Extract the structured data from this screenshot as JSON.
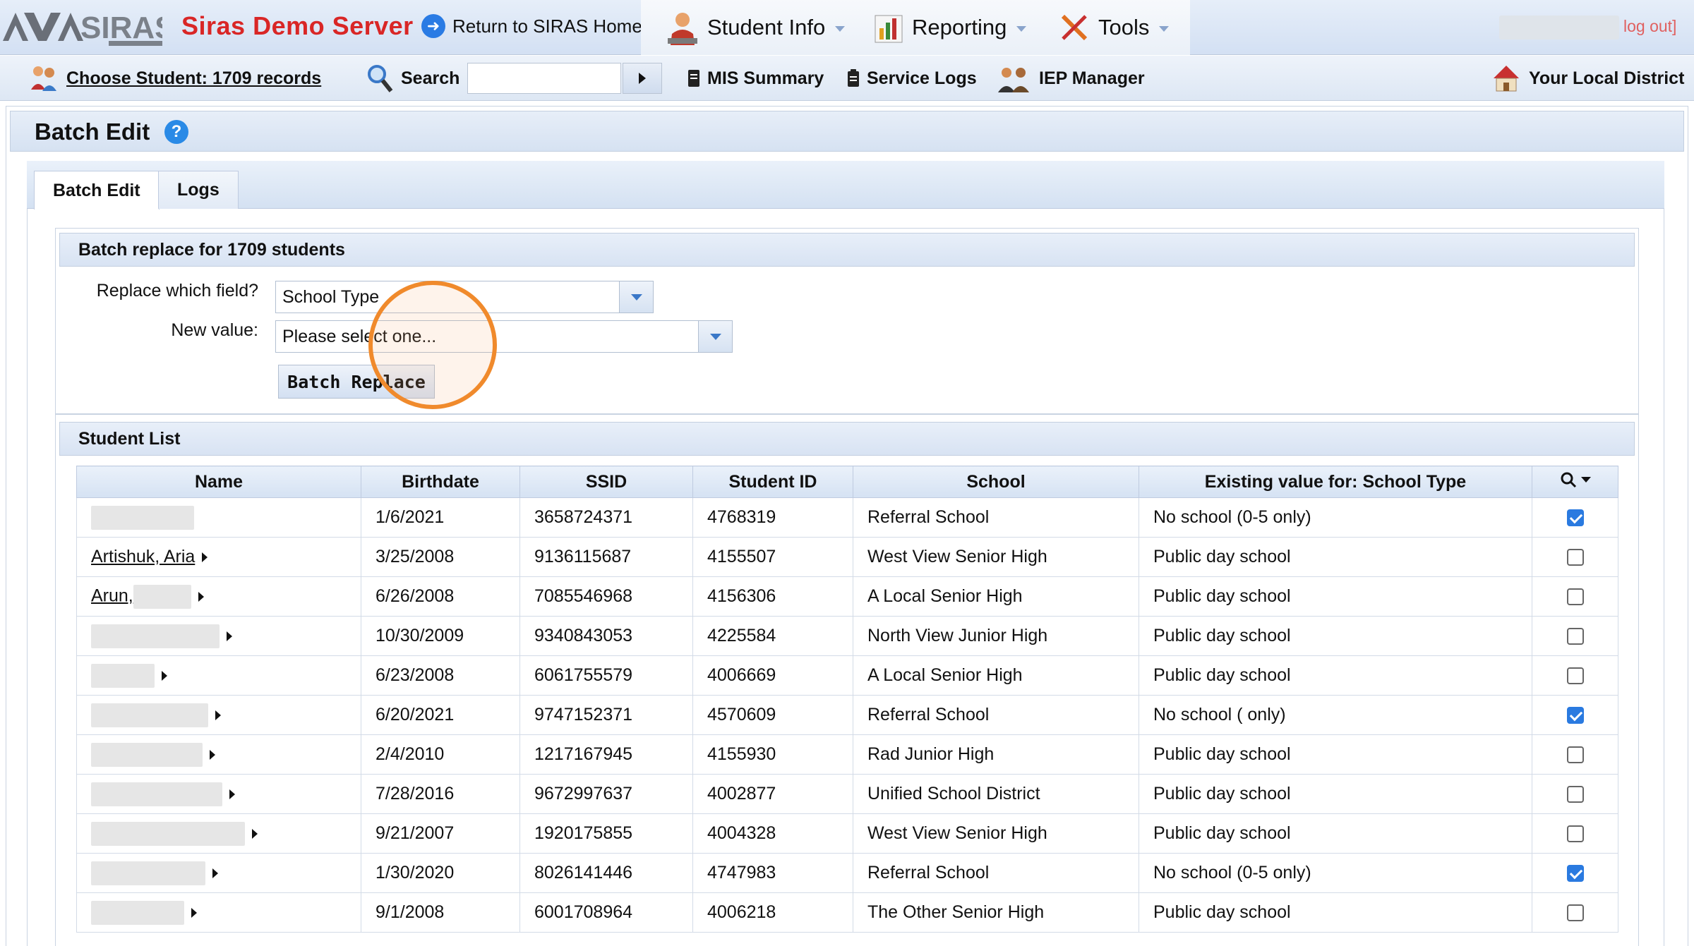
{
  "header": {
    "server_name": "Siras Demo Server",
    "return_home": "Return to SIRAS Home",
    "menu": [
      {
        "label": "Student Info",
        "icon": "student-icon"
      },
      {
        "label": "Reporting",
        "icon": "reporting-icon"
      },
      {
        "label": "Tools",
        "icon": "tools-icon"
      }
    ],
    "logout": "log out]"
  },
  "toolbar": {
    "choose_student": "Choose Student: 1709 records",
    "search_label": "Search",
    "search_value": "",
    "mis_summary": "MIS Summary",
    "service_logs": "Service Logs",
    "iep_manager": "IEP Manager",
    "district": "Your Local District"
  },
  "page": {
    "title": "Batch Edit",
    "help": "?"
  },
  "tabs": [
    {
      "label": "Batch Edit",
      "active": true
    },
    {
      "label": "Logs",
      "active": false
    }
  ],
  "batch": {
    "header": "Batch replace for 1709 students",
    "field_label": "Replace which field?",
    "field_value": "School Type",
    "value_label": "New value:",
    "value_placeholder": "Please select one...",
    "button": "Batch Replace"
  },
  "student_list": {
    "header": "Student List",
    "columns": [
      "Name",
      "Birthdate",
      "SSID",
      "Student ID",
      "School",
      "Existing value for: School Type"
    ],
    "rows": [
      {
        "name": "",
        "blur_w": 0,
        "birthdate": "1/6/2021",
        "ssid": "3658724371",
        "student_id": "4768319",
        "school": "Referral School",
        "existing": "No school (0-5 only)",
        "checked": true
      },
      {
        "name": "Artishuk, Aria",
        "birthdate": "3/25/2008",
        "ssid": "9136115687",
        "student_id": "4155507",
        "school": "West View Senior High",
        "existing": "Public day school",
        "checked": false
      },
      {
        "name": "Arun,",
        "birthdate": "6/26/2008",
        "ssid": "7085546968",
        "student_id": "4156306",
        "school": "A Local Senior High",
        "existing": "Public day school",
        "checked": false
      },
      {
        "name": "",
        "birthdate": "10/30/2009",
        "ssid": "9340843053",
        "student_id": "4225584",
        "school": "North View Junior High",
        "existing": "Public day school",
        "checked": false
      },
      {
        "name": "",
        "birthdate": "6/23/2008",
        "ssid": "6061755579",
        "student_id": "4006669",
        "school": "A Local Senior High",
        "existing": "Public day school",
        "checked": false
      },
      {
        "name": "",
        "birthdate": "6/20/2021",
        "ssid": "9747152371",
        "student_id": "4570609",
        "school": "Referral School",
        "existing": "No school ( only)",
        "checked": true
      },
      {
        "name": "",
        "birthdate": "2/4/2010",
        "ssid": "1217167945",
        "student_id": "4155930",
        "school": "Rad Junior High",
        "existing": "Public day school",
        "checked": false
      },
      {
        "name": "",
        "birthdate": "7/28/2016",
        "ssid": "9672997637",
        "student_id": "4002877",
        "school": "Unified School District",
        "existing": "Public day school",
        "checked": false
      },
      {
        "name": "",
        "birthdate": "9/21/2007",
        "ssid": "1920175855",
        "student_id": "4004328",
        "school": "West View Senior High",
        "existing": "Public day school",
        "checked": false
      },
      {
        "name": "",
        "birthdate": "1/30/2020",
        "ssid": "8026141446",
        "student_id": "4747983",
        "school": "Referral School",
        "existing": "No school (0-5 only)",
        "checked": true
      },
      {
        "name": "",
        "birthdate": "9/1/2008",
        "ssid": "6001708964",
        "student_id": "4006218",
        "school": "The Other Senior High",
        "existing": "Public day school",
        "checked": false
      }
    ]
  },
  "colors": {
    "brand_red": "#d92626",
    "accent_blue": "#2a7ae0",
    "highlight_ring": "#f08a2c"
  }
}
